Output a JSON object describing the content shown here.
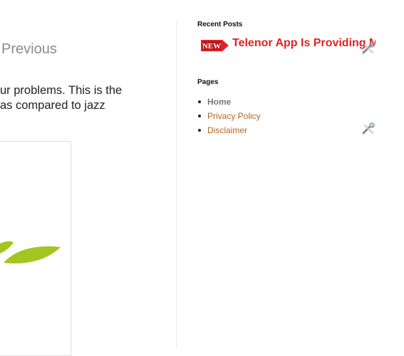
{
  "post_nav": {
    "previous_label": "Previous"
  },
  "excerpt": {
    "line1": "ur problems. This is the",
    "line2": "as compared to jazz"
  },
  "sidebar": {
    "recent_posts": {
      "title": "Recent Posts",
      "badge_text": "NEW",
      "ticker_text": "Telenor App Is Providing M"
    },
    "pages": {
      "title": "Pages",
      "items": [
        {
          "label": "Home"
        },
        {
          "label": "Privacy Policy"
        },
        {
          "label": "Disclaimer"
        }
      ]
    }
  },
  "colors": {
    "ticker_red": "#e32222",
    "page_link": "#b5661e",
    "leaf_green": "#a3c51f"
  },
  "icons": [
    "tools-icon",
    "new-badge-icon",
    "leaf-graphic"
  ]
}
